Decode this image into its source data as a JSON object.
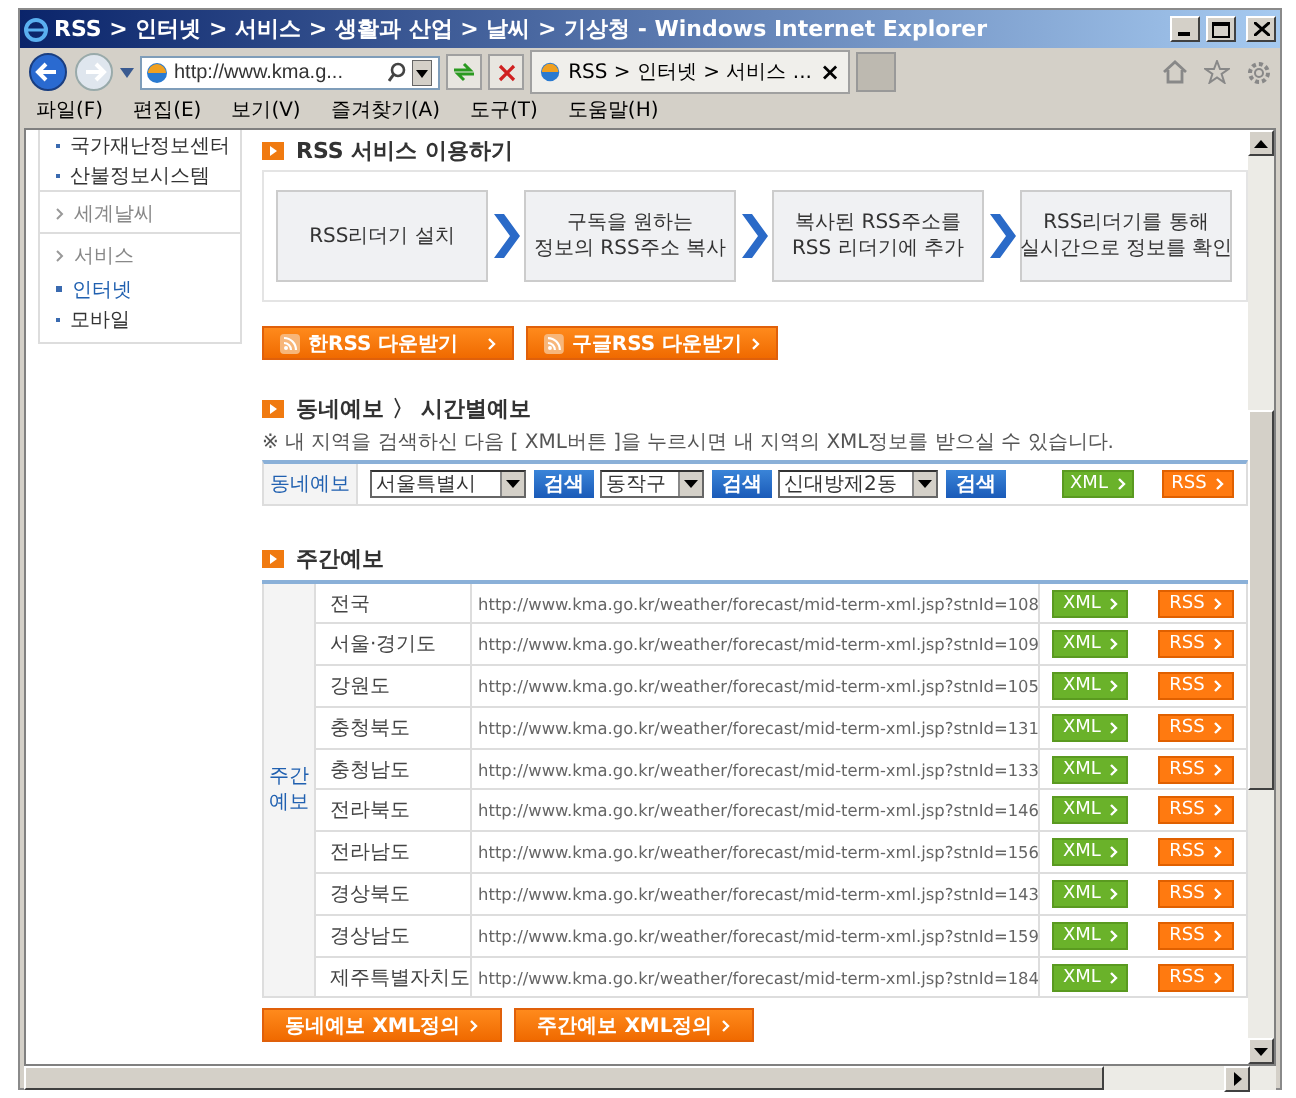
{
  "window": {
    "title": "RSS > 인터넷 > 서비스 > 생활과 산업 > 날씨 > 기상청 - Windows Internet Explorer"
  },
  "address_bar": {
    "value": "http://www.kma.g..."
  },
  "tab": {
    "label": "RSS > 인터넷 > 서비스 ...",
    "close": "×"
  },
  "menu": [
    "파일(F)",
    "편집(E)",
    "보기(V)",
    "즐겨찾기(A)",
    "도구(T)",
    "도움말(H)"
  ],
  "sidebar": {
    "items": [
      {
        "label": "국가재난정보센터",
        "kind": "sub",
        "selected": false
      },
      {
        "label": "산불정보시스템",
        "kind": "sub",
        "selected": false
      },
      {
        "label": "세계날씨",
        "kind": "section",
        "selected": false
      },
      {
        "label": "서비스",
        "kind": "section",
        "selected": false
      },
      {
        "label": "인터넷",
        "kind": "sub",
        "selected": true
      },
      {
        "label": "모바일",
        "kind": "sub",
        "selected": false
      }
    ]
  },
  "rss_service": {
    "title": "RSS 서비스 이용하기",
    "steps": [
      "RSS리더기 설치",
      "구독을 원하는\n정보의 RSS주소 복사",
      "복사된 RSS주소를\nRSS 리더기에 추가",
      "RSS리더기를 통해\n실시간으로 정보를 확인"
    ],
    "buttons": [
      "한RSS 다운받기",
      "구글RSS 다운받기"
    ]
  },
  "local_forecast": {
    "title": "동네예보 〉 시간별예보",
    "note": "※ 내 지역을 검색하신 다음 [ XML버튼 ]을 누르시면 내 지역의 XML정보를 받으실 수 있습니다.",
    "label": "동네예보",
    "selects": [
      {
        "value": "서울특별시",
        "button": "검색"
      },
      {
        "value": "동작구",
        "button": "검색"
      },
      {
        "value": "신대방제2동",
        "button": "검색"
      }
    ],
    "xml_button": "XML",
    "rss_button": "RSS"
  },
  "weekly_forecast": {
    "title": "주간예보",
    "group_label": "주간예보",
    "rows": [
      {
        "region": "전국",
        "url": "http://www.kma.go.kr/weather/forecast/mid-term-xml.jsp?stnId=108",
        "xml": "XML",
        "rss": "RSS"
      },
      {
        "region": "서울·경기도",
        "url": "http://www.kma.go.kr/weather/forecast/mid-term-xml.jsp?stnId=109",
        "xml": "XML",
        "rss": "RSS"
      },
      {
        "region": "강원도",
        "url": "http://www.kma.go.kr/weather/forecast/mid-term-xml.jsp?stnId=105",
        "xml": "XML",
        "rss": "RSS"
      },
      {
        "region": "충청북도",
        "url": "http://www.kma.go.kr/weather/forecast/mid-term-xml.jsp?stnId=131",
        "xml": "XML",
        "rss": "RSS"
      },
      {
        "region": "충청남도",
        "url": "http://www.kma.go.kr/weather/forecast/mid-term-xml.jsp?stnId=133",
        "xml": "XML",
        "rss": "RSS"
      },
      {
        "region": "전라북도",
        "url": "http://www.kma.go.kr/weather/forecast/mid-term-xml.jsp?stnId=146",
        "xml": "XML",
        "rss": "RSS"
      },
      {
        "region": "전라남도",
        "url": "http://www.kma.go.kr/weather/forecast/mid-term-xml.jsp?stnId=156",
        "xml": "XML",
        "rss": "RSS"
      },
      {
        "region": "경상북도",
        "url": "http://www.kma.go.kr/weather/forecast/mid-term-xml.jsp?stnId=143",
        "xml": "XML",
        "rss": "RSS"
      },
      {
        "region": "경상남도",
        "url": "http://www.kma.go.kr/weather/forecast/mid-term-xml.jsp?stnId=159",
        "xml": "XML",
        "rss": "RSS"
      },
      {
        "region": "제주특별자치도",
        "url": "http://www.kma.go.kr/weather/forecast/mid-term-xml.jsp?stnId=184",
        "xml": "XML",
        "rss": "RSS"
      }
    ]
  },
  "bottom_buttons": [
    "동네예보 XML정의",
    "주간예보 XML정의"
  ]
}
